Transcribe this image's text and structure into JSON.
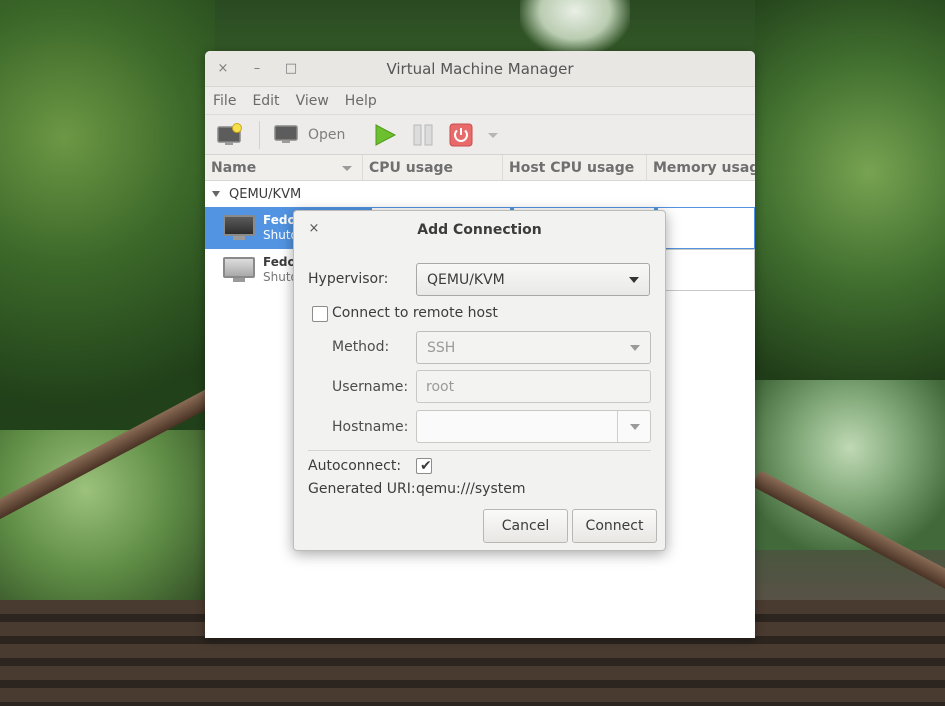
{
  "window": {
    "title": "Virtual Machine Manager",
    "close_glyph": "×",
    "minimize_glyph": "–",
    "maximize_glyph": "□"
  },
  "menu": [
    "File",
    "Edit",
    "View",
    "Help"
  ],
  "toolbar": {
    "open_label": "Open"
  },
  "columns": [
    "Name",
    "CPU usage",
    "Host CPU usage",
    "Memory usage"
  ],
  "list": {
    "group_label": "QEMU/KVM",
    "vms": [
      {
        "name": "Fedor",
        "status": "Shuto",
        "selected": true
      },
      {
        "name": "Fedor",
        "status": "Shuto",
        "selected": false
      }
    ]
  },
  "dialog": {
    "title": "Add Connection",
    "close_glyph": "×",
    "hypervisor_label": "Hypervisor:",
    "hypervisor_value": "QEMU/KVM",
    "remote_label": "Connect to remote host",
    "remote_checked": false,
    "method_label": "Method:",
    "method_value": "SSH",
    "username_label": "Username:",
    "username_placeholder": "root",
    "hostname_label": "Hostname:",
    "hostname_value": "",
    "autoconnect_label": "Autoconnect:",
    "autoconnect_checked": true,
    "uri_label": "Generated URI:",
    "uri_value": "qemu:///system",
    "cancel_label": "Cancel",
    "connect_label": "Connect"
  },
  "colors": {
    "selection": "#5294e2",
    "run_green": "#6cbf2e",
    "shutdown_red": "#e35b5b"
  }
}
